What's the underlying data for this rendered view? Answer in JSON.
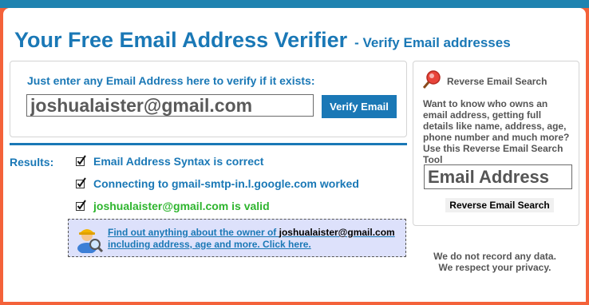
{
  "header": {
    "title": "Your Free Email Address Verifier",
    "subtitle": "- Verify Email addresses"
  },
  "verify": {
    "prompt": "Just enter any Email Address here to verify if it exists:",
    "email_value": "joshualaister@gmail.com",
    "button_label": "Verify Email"
  },
  "results": {
    "label": "Results:",
    "items": [
      {
        "text": "Email Address Syntax is correct",
        "status": "ok"
      },
      {
        "text": "Connecting to gmail-smtp-in.l.google.com worked",
        "status": "ok"
      },
      {
        "text": "joshualaister@gmail.com is valid",
        "status": "valid"
      }
    ]
  },
  "owner_promo": {
    "line1_prefix": "Find out anything about the owner of ",
    "email": "joshualaister@gmail.com",
    "line2": "including address, age and more. Click here."
  },
  "reverse_search": {
    "title": "Reverse Email Search",
    "description": "Want to know who owns an email address, getting full details like name, address, age, phone number and much more? Use this Reverse Email Search Tool",
    "input_placeholder": "Email Address",
    "button_label": "Reverse Email Search"
  },
  "privacy": {
    "line1": "We do not record any data.",
    "line2": "We respect your privacy."
  },
  "colors": {
    "brand_blue": "#1a78b6",
    "valid_green": "#2eb52e",
    "background_orange": "#f4623a",
    "promo_background": "#dde1fb"
  },
  "icons": {
    "check": "checkmark-icon",
    "owner": "detective-user-icon",
    "reverse_search": "magnifier-icon"
  }
}
